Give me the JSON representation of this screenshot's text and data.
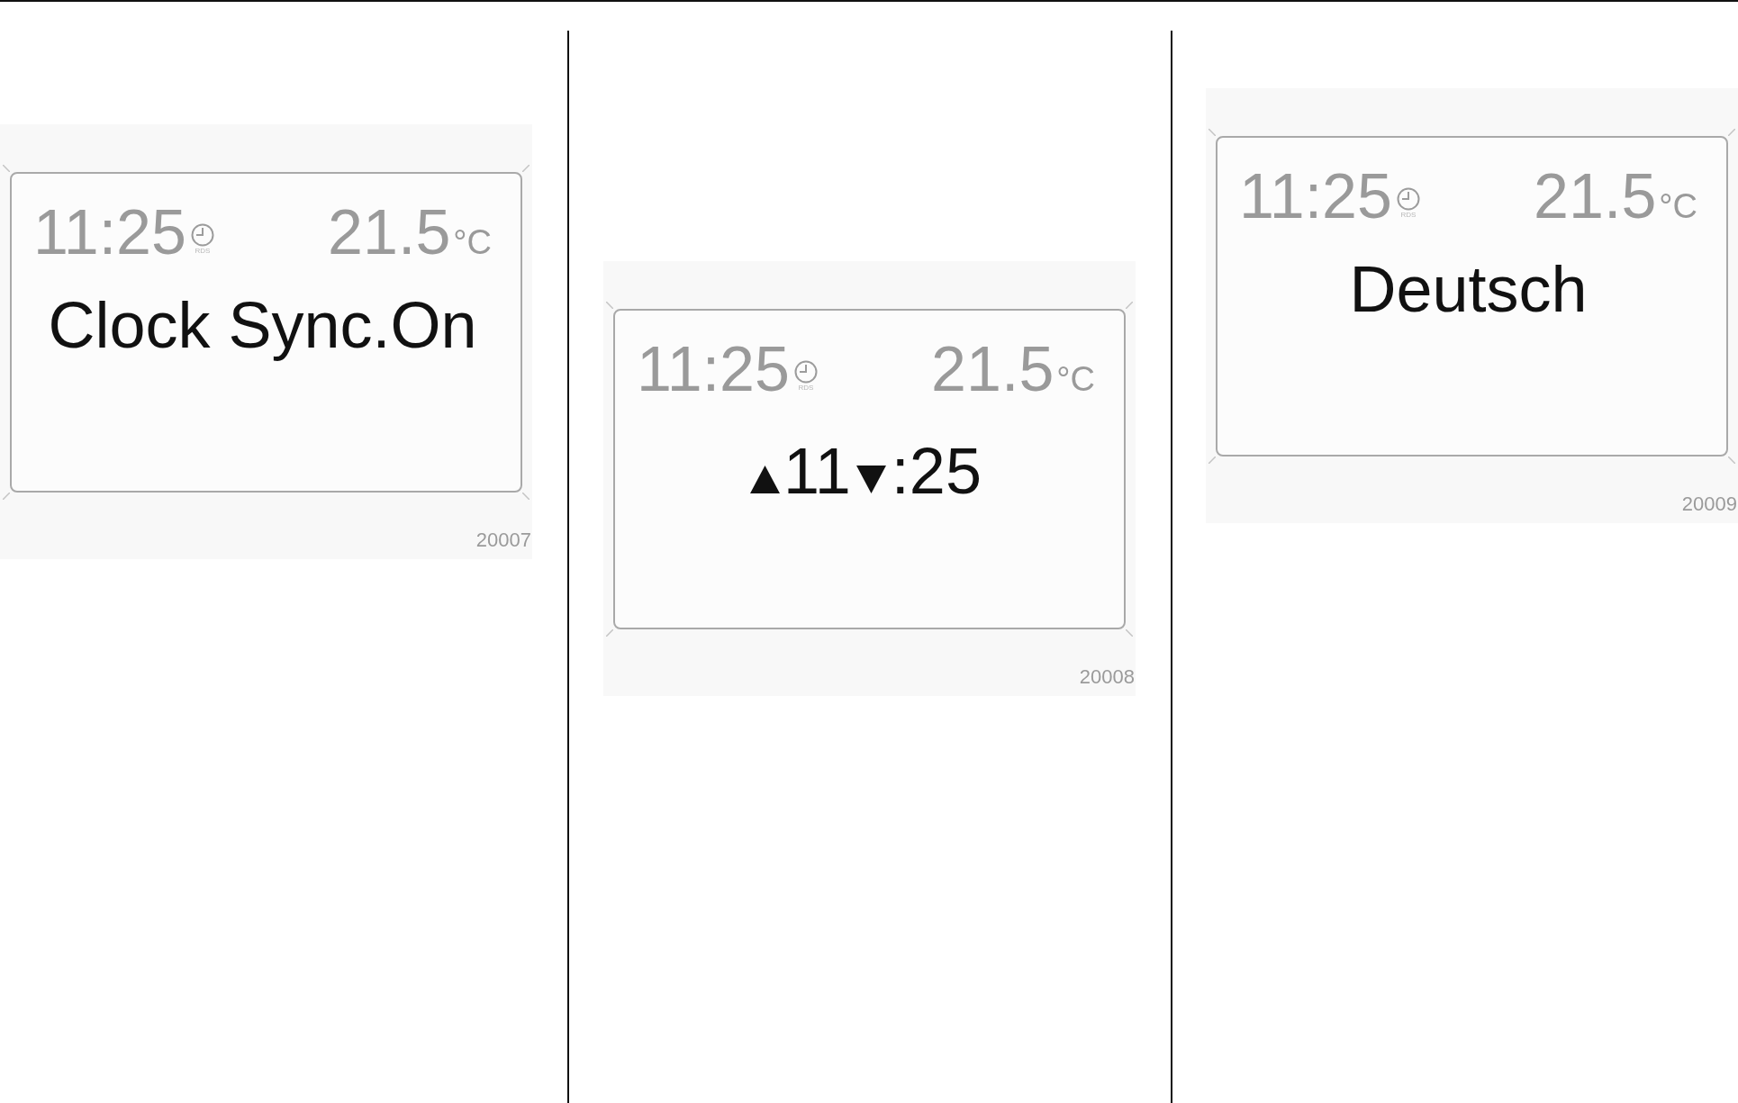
{
  "figures": [
    {
      "display": {
        "clock": "11:25",
        "rds_label": "RDS",
        "temperature": "21.5",
        "temperature_unit": "°C",
        "message": {
          "kind": "text",
          "text": "Clock Sync.On"
        }
      },
      "figure_number": "20007"
    },
    {
      "display": {
        "clock": "11:25",
        "rds_label": "RDS",
        "temperature": "21.5",
        "temperature_unit": "°C",
        "message": {
          "kind": "time_setting",
          "hours": "11",
          "minutes": ":25"
        }
      },
      "figure_number": "20008"
    },
    {
      "display": {
        "clock": "11:25",
        "rds_label": "RDS",
        "temperature": "21.5",
        "temperature_unit": "°C",
        "message": {
          "kind": "text",
          "text": "Deutsch"
        }
      },
      "figure_number": "20009"
    }
  ]
}
